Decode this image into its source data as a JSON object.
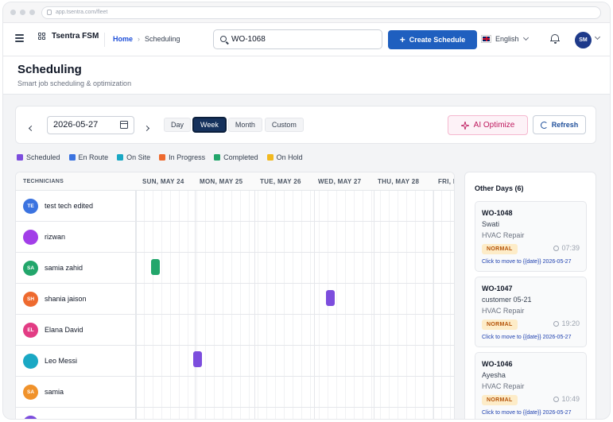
{
  "browser": {
    "url": "app.tsentra.com/fleet"
  },
  "header": {
    "brand": "Tsentra FSM",
    "breadcrumb": {
      "home": "Home",
      "separator": "›",
      "current": "Scheduling"
    },
    "search_value": "WO-1068",
    "create_label": "Create Schedule",
    "language": "English",
    "user_initials": "SM"
  },
  "page": {
    "title": "Scheduling",
    "subtitle": "Smart job scheduling & optimization"
  },
  "toolbar": {
    "date": "2026-05-27",
    "views": [
      "Day",
      "Week",
      "Month",
      "Custom"
    ],
    "active_view": "Week",
    "ai_label": "AI Optimize",
    "refresh_label": "Refresh"
  },
  "legend": [
    {
      "label": "Scheduled",
      "color": "#7c4ddd"
    },
    {
      "label": "En Route",
      "color": "#3b73e0"
    },
    {
      "label": "On Site",
      "color": "#1aa8c4"
    },
    {
      "label": "In Progress",
      "color": "#ee6a2f"
    },
    {
      "label": "Completed",
      "color": "#22a66b"
    },
    {
      "label": "On Hold",
      "color": "#f2b91f"
    }
  ],
  "grid": {
    "technicians_header": "TECHNICIANS",
    "days": [
      "SUN, MAY 24",
      "MON, MAY 25",
      "TUE, MAY 26",
      "WED, MAY 27",
      "THU, MAY 28",
      "FRI, M"
    ],
    "technicians": [
      {
        "initials": "TE",
        "name": "test tech edited",
        "color": "#3b73e0"
      },
      {
        "initials": "",
        "name": "rizwan",
        "color": "#a23ee8"
      },
      {
        "initials": "SA",
        "name": "samia zahid",
        "color": "#22a66b"
      },
      {
        "initials": "SH",
        "name": "shania jaison",
        "color": "#ee6a2f"
      },
      {
        "initials": "EL",
        "name": "Elana David",
        "color": "#e23c84"
      },
      {
        "initials": "",
        "name": "Leo Messi",
        "color": "#1aa8c4"
      },
      {
        "initials": "SA",
        "name": "samia",
        "color": "#f0922b"
      },
      {
        "initials": "",
        "name": "",
        "color": "#7c4ddd"
      }
    ]
  },
  "side": {
    "title": "Other Days (6)",
    "cards": [
      {
        "wo": "WO-1048",
        "customer": "Swati",
        "service": "HVAC Repair",
        "priority": "NORMAL",
        "time": "07:39",
        "move": "Click to move to {{date}} 2026-05-27"
      },
      {
        "wo": "WO-1047",
        "customer": "customer 05-21",
        "service": "HVAC Repair",
        "priority": "NORMAL",
        "time": "19:20",
        "move": "Click to move to {{date}} 2026-05-27"
      },
      {
        "wo": "WO-1046",
        "customer": "Ayesha",
        "service": "HVAC Repair",
        "priority": "NORMAL",
        "time": "10:49",
        "move": "Click to move to {{date}} 2026-05-27"
      }
    ]
  }
}
